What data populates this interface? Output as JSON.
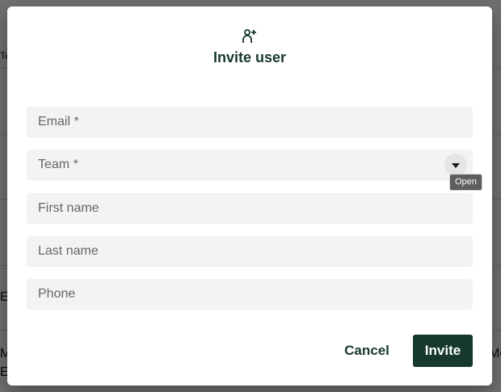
{
  "background": {
    "fragments": {
      "top_left": "Te",
      "mid_left": "E",
      "bottom_left_1": "M",
      "bottom_left_2": "E",
      "bottom_right": "Mo"
    }
  },
  "modal": {
    "icon": "person-add-icon",
    "title": "Invite user",
    "fields": {
      "email_placeholder": "Email *",
      "team_placeholder": "Team *",
      "first_name_placeholder": "First name",
      "last_name_placeholder": "Last name",
      "phone_placeholder": "Phone"
    },
    "team_dropdown_icon": "caret-down-icon",
    "tooltip": "Open",
    "buttons": {
      "cancel": "Cancel",
      "invite": "Invite"
    }
  },
  "colors": {
    "primary": "#17382e",
    "field_bg": "#f3f3f3"
  }
}
